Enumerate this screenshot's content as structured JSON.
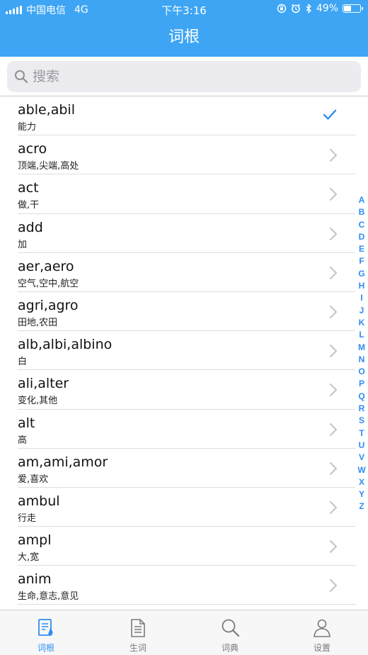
{
  "status_bar": {
    "carrier": "中国电信",
    "network": "4G",
    "time": "下午3:16",
    "battery": "49%",
    "battery_level": 0.49
  },
  "header": {
    "title": "词根"
  },
  "search": {
    "placeholder": "搜索"
  },
  "list": [
    {
      "term": "able,abil",
      "meaning": "能力",
      "selected": true
    },
    {
      "term": "acro",
      "meaning": "顶端,尖端,高处",
      "selected": false
    },
    {
      "term": "act",
      "meaning": "做,干",
      "selected": false
    },
    {
      "term": "add",
      "meaning": "加",
      "selected": false
    },
    {
      "term": "aer,aero",
      "meaning": "空气,空中,航空",
      "selected": false
    },
    {
      "term": "agri,agro",
      "meaning": "田地,农田",
      "selected": false
    },
    {
      "term": "alb,albi,albino",
      "meaning": "白",
      "selected": false
    },
    {
      "term": "ali,alter",
      "meaning": "变化,其他",
      "selected": false
    },
    {
      "term": "alt",
      "meaning": "高",
      "selected": false
    },
    {
      "term": "am,ami,amor",
      "meaning": "爱,喜欢",
      "selected": false
    },
    {
      "term": "ambul",
      "meaning": "行走",
      "selected": false
    },
    {
      "term": "ampl",
      "meaning": "大,宽",
      "selected": false
    },
    {
      "term": "anim",
      "meaning": "生命,意志,意见",
      "selected": false
    }
  ],
  "index_letters": [
    "A",
    "B",
    "C",
    "D",
    "E",
    "F",
    "G",
    "H",
    "I",
    "J",
    "K",
    "L",
    "M",
    "N",
    "O",
    "P",
    "Q",
    "R",
    "S",
    "T",
    "U",
    "V",
    "W",
    "X",
    "Y",
    "Z"
  ],
  "tabs": [
    {
      "label": "词根",
      "icon": "roots-icon",
      "active": true
    },
    {
      "label": "生词",
      "icon": "document-icon",
      "active": false
    },
    {
      "label": "词典",
      "icon": "search-icon",
      "active": false
    },
    {
      "label": "设置",
      "icon": "user-icon",
      "active": false
    }
  ],
  "colors": {
    "header_bg": "#3da5f4",
    "accent": "#2f8df0",
    "tab_inactive": "#7a7a7a"
  }
}
